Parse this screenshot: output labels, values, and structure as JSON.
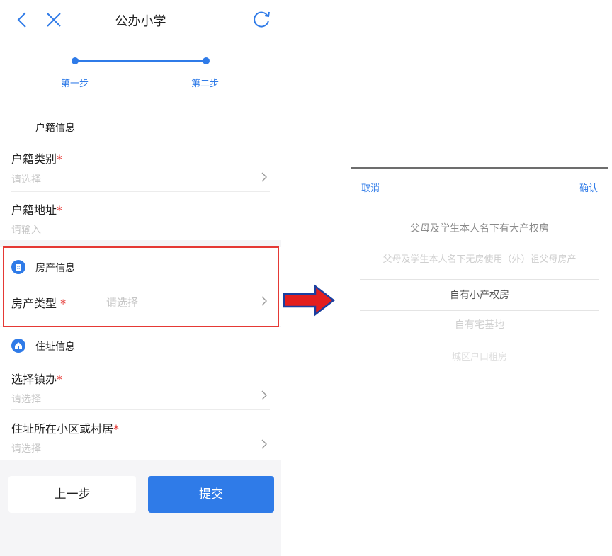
{
  "header": {
    "title": "公办小学"
  },
  "steps": {
    "step1": "第一步",
    "step2": "第二步"
  },
  "household": {
    "section_title": "户籍信息",
    "type_label": "户籍类别",
    "type_placeholder": "请选择",
    "address_label": "户籍地址",
    "address_placeholder": "请输入",
    "required_mark": "*"
  },
  "property": {
    "section_title": "房产信息",
    "type_label": "房产类型",
    "type_placeholder": "请选择",
    "required_mark": "*"
  },
  "residence": {
    "section_title": "住址信息",
    "town_label": "选择镇办",
    "town_placeholder": "请选择",
    "community_label": "住址所在小区或村居",
    "community_placeholder": "请选择",
    "required_mark": "*"
  },
  "actions": {
    "prev": "上一步",
    "submit": "提交"
  },
  "picker": {
    "cancel": "取消",
    "confirm": "确认",
    "options": [
      "父母及学生本人名下有大产权房",
      "父母及学生本人名下无房使用（外）祖父母房产",
      "自有小产权房",
      "自有宅基地",
      "城区户口租房"
    ],
    "selected": "自有小产权房"
  },
  "colors": {
    "accent": "#2f7be8",
    "required": "#e53935",
    "highlight_border": "#e53935",
    "arrow": "#e31e1e"
  }
}
